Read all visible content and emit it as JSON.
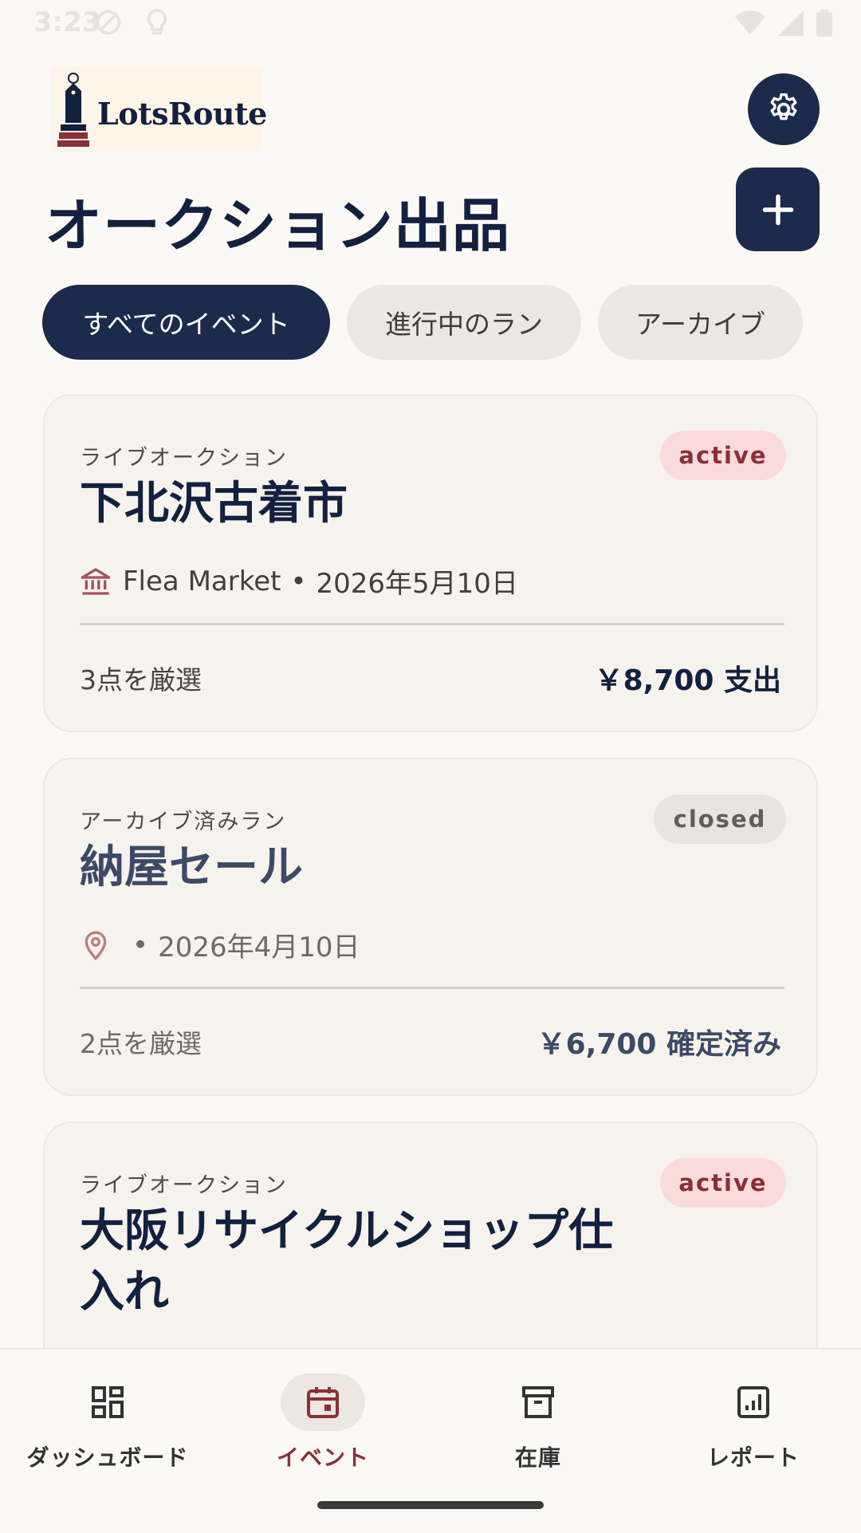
{
  "status_bar": {
    "time": "3:23"
  },
  "header": {
    "logo_text": "LotsRoute",
    "page_title": "オークション出品"
  },
  "filters": [
    {
      "label": "すべてのイベント",
      "selected": true
    },
    {
      "label": "進行中のラン",
      "selected": false
    },
    {
      "label": "アーカイブ",
      "selected": false
    }
  ],
  "cards": [
    {
      "type": "ライブオークション",
      "status": "active",
      "title": "下北沢古着市",
      "venue": "Flea Market",
      "separator": "•",
      "date": "2026年5月10日",
      "items": "3点を厳選",
      "amount": "￥8,700 支出"
    },
    {
      "type": "アーカイブ済みラン",
      "status": "closed",
      "title": "納屋セール",
      "venue": "",
      "separator": "•",
      "date": "2026年4月10日",
      "items": "2点を厳選",
      "amount": "￥6,700 確定済み"
    },
    {
      "type": "ライブオークション",
      "status": "active",
      "title_line1": "大阪リサイクルショップ仕",
      "title_line2": "入れ"
    }
  ],
  "bottom_nav": [
    {
      "label": "ダッシュボード",
      "icon": "dashboard-icon",
      "selected": false
    },
    {
      "label": "イベント",
      "icon": "calendar-icon",
      "selected": true
    },
    {
      "label": "在庫",
      "icon": "archive-box-icon",
      "selected": false
    },
    {
      "label": "レポート",
      "icon": "report-chart-icon",
      "selected": false
    }
  ],
  "colors": {
    "primary": "#1c2a4b",
    "accent": "#8a2f36",
    "background": "#fbf9f5",
    "badge_active_bg": "#fadadb",
    "badge_closed_bg": "#e8e5df"
  }
}
